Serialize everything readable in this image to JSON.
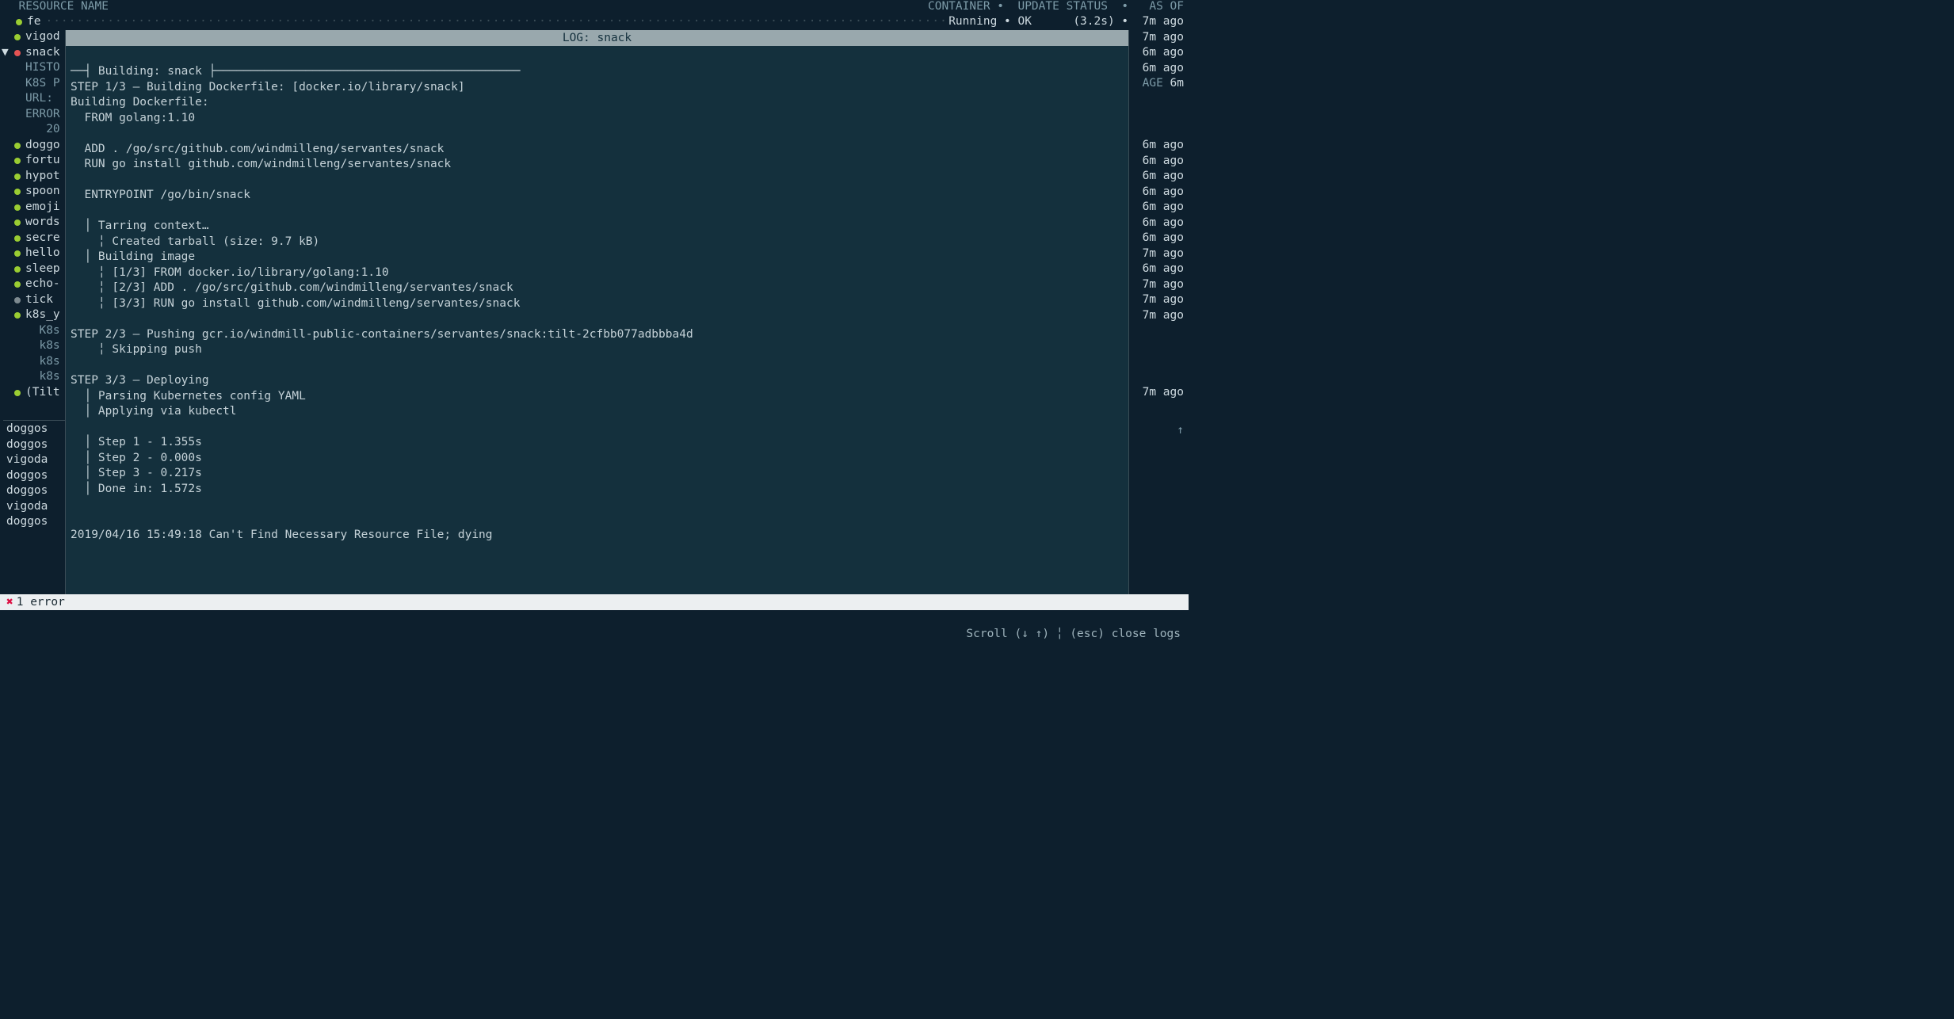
{
  "header": {
    "left": "  RESOURCE NAME",
    "right": "CONTAINER •  UPDATE STATUS  •   AS OF"
  },
  "toprow": {
    "name": "fe",
    "status": "Running • OK      (3.2s) •  7m ago"
  },
  "sidebar": {
    "items": [
      {
        "dot": "green",
        "label": "vigod",
        "dim": false
      },
      {
        "dot": "red",
        "label": "snack",
        "dim": false,
        "selected": true
      },
      {
        "dot": "none",
        "label": "HISTO",
        "dim": true
      },
      {
        "dot": "none",
        "label": "K8S P",
        "dim": true
      },
      {
        "dot": "none",
        "label": "URL:",
        "dim": true
      },
      {
        "dot": "none",
        "label": "ERROR",
        "dim": true
      },
      {
        "dot": "none",
        "label": "   20",
        "dim": true
      },
      {
        "dot": "green",
        "label": "doggo",
        "dim": false
      },
      {
        "dot": "green",
        "label": "fortu",
        "dim": false
      },
      {
        "dot": "green",
        "label": "hypot",
        "dim": false
      },
      {
        "dot": "green",
        "label": "spoon",
        "dim": false
      },
      {
        "dot": "green",
        "label": "emoji",
        "dim": false
      },
      {
        "dot": "green",
        "label": "words",
        "dim": false
      },
      {
        "dot": "green",
        "label": "secre",
        "dim": false
      },
      {
        "dot": "green",
        "label": "hello",
        "dim": false
      },
      {
        "dot": "green",
        "label": "sleep",
        "dim": false
      },
      {
        "dot": "green",
        "label": "echo-",
        "dim": false
      },
      {
        "dot": "grey",
        "label": "tick",
        "dim": false
      },
      {
        "dot": "green",
        "label": "k8s_y",
        "dim": false
      },
      {
        "dot": "none",
        "label": "  K8s",
        "dim": true
      },
      {
        "dot": "none",
        "label": "  k8s",
        "dim": true
      },
      {
        "dot": "none",
        "label": "  k8s",
        "dim": true
      },
      {
        "dot": "none",
        "label": "  k8s",
        "dim": true
      },
      {
        "dot": "green",
        "label": "(Tilt",
        "dim": false
      }
    ],
    "bottom_log_names": [
      "doggos",
      "doggos",
      "vigoda",
      "doggos",
      "doggos",
      "vigoda",
      "doggos"
    ]
  },
  "rightcol": {
    "times": [
      "7m ago",
      "6m ago",
      "6m ago",
      "AGE 6m",
      "",
      "",
      "",
      "6m ago",
      "6m ago",
      "6m ago",
      "6m ago",
      "6m ago",
      "6m ago",
      "6m ago",
      "7m ago",
      "6m ago",
      "7m ago",
      "7m ago",
      "7m ago",
      "",
      "",
      "",
      "",
      "7m ago"
    ]
  },
  "log": {
    "title": "LOG: snack",
    "lines": [
      "",
      "──┤ Building: snack ├────────────────────────────────────────────",
      "STEP 1/3 — Building Dockerfile: [docker.io/library/snack]",
      "Building Dockerfile:",
      "  FROM golang:1.10",
      "",
      "  ADD . /go/src/github.com/windmilleng/servantes/snack",
      "  RUN go install github.com/windmilleng/servantes/snack",
      "",
      "  ENTRYPOINT /go/bin/snack",
      "",
      "  │ Tarring context…",
      "    ╎ Created tarball (size: 9.7 kB)",
      "  │ Building image",
      "    ╎ [1/3] FROM docker.io/library/golang:1.10",
      "    ╎ [2/3] ADD . /go/src/github.com/windmilleng/servantes/snack",
      "    ╎ [3/3] RUN go install github.com/windmilleng/servantes/snack",
      "",
      "STEP 2/3 — Pushing gcr.io/windmill-public-containers/servantes/snack:tilt-2cfbb077adbbba4d",
      "    ╎ Skipping push",
      "",
      "STEP 3/3 — Deploying",
      "  │ Parsing Kubernetes config YAML",
      "  │ Applying via kubectl",
      "",
      "  │ Step 1 - 1.355s",
      "  │ Step 2 - 0.000s",
      "  │ Step 3 - 0.217s",
      "  │ Done in: 1.572s",
      "",
      "",
      "2019/04/16 15:49:18 Can't Find Necessary Resource File; dying",
      ""
    ]
  },
  "statusbar": {
    "error_count": "1 error"
  },
  "helpbar": {
    "text": "Scroll (↓ ↑) ╎ (esc) close logs"
  }
}
